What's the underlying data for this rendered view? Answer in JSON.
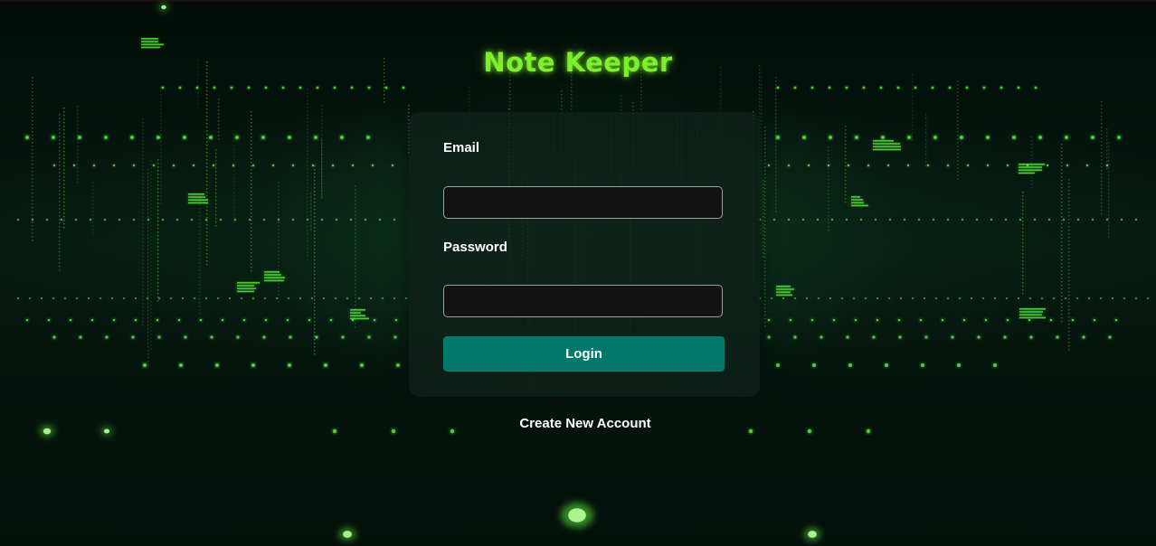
{
  "app": {
    "title": "Note Keeper"
  },
  "form": {
    "email_label": "Email",
    "email_value": "",
    "password_label": "Password",
    "password_value": "",
    "login_label": "Login"
  },
  "links": {
    "create_account": "Create New Account"
  },
  "colors": {
    "background": "#04110c",
    "title_green": "#7cf02a",
    "particle_green": "#5cf03c",
    "card": "#0e2018",
    "input_bg": "#121212",
    "button": "#00796b",
    "text": "#ffffff"
  }
}
